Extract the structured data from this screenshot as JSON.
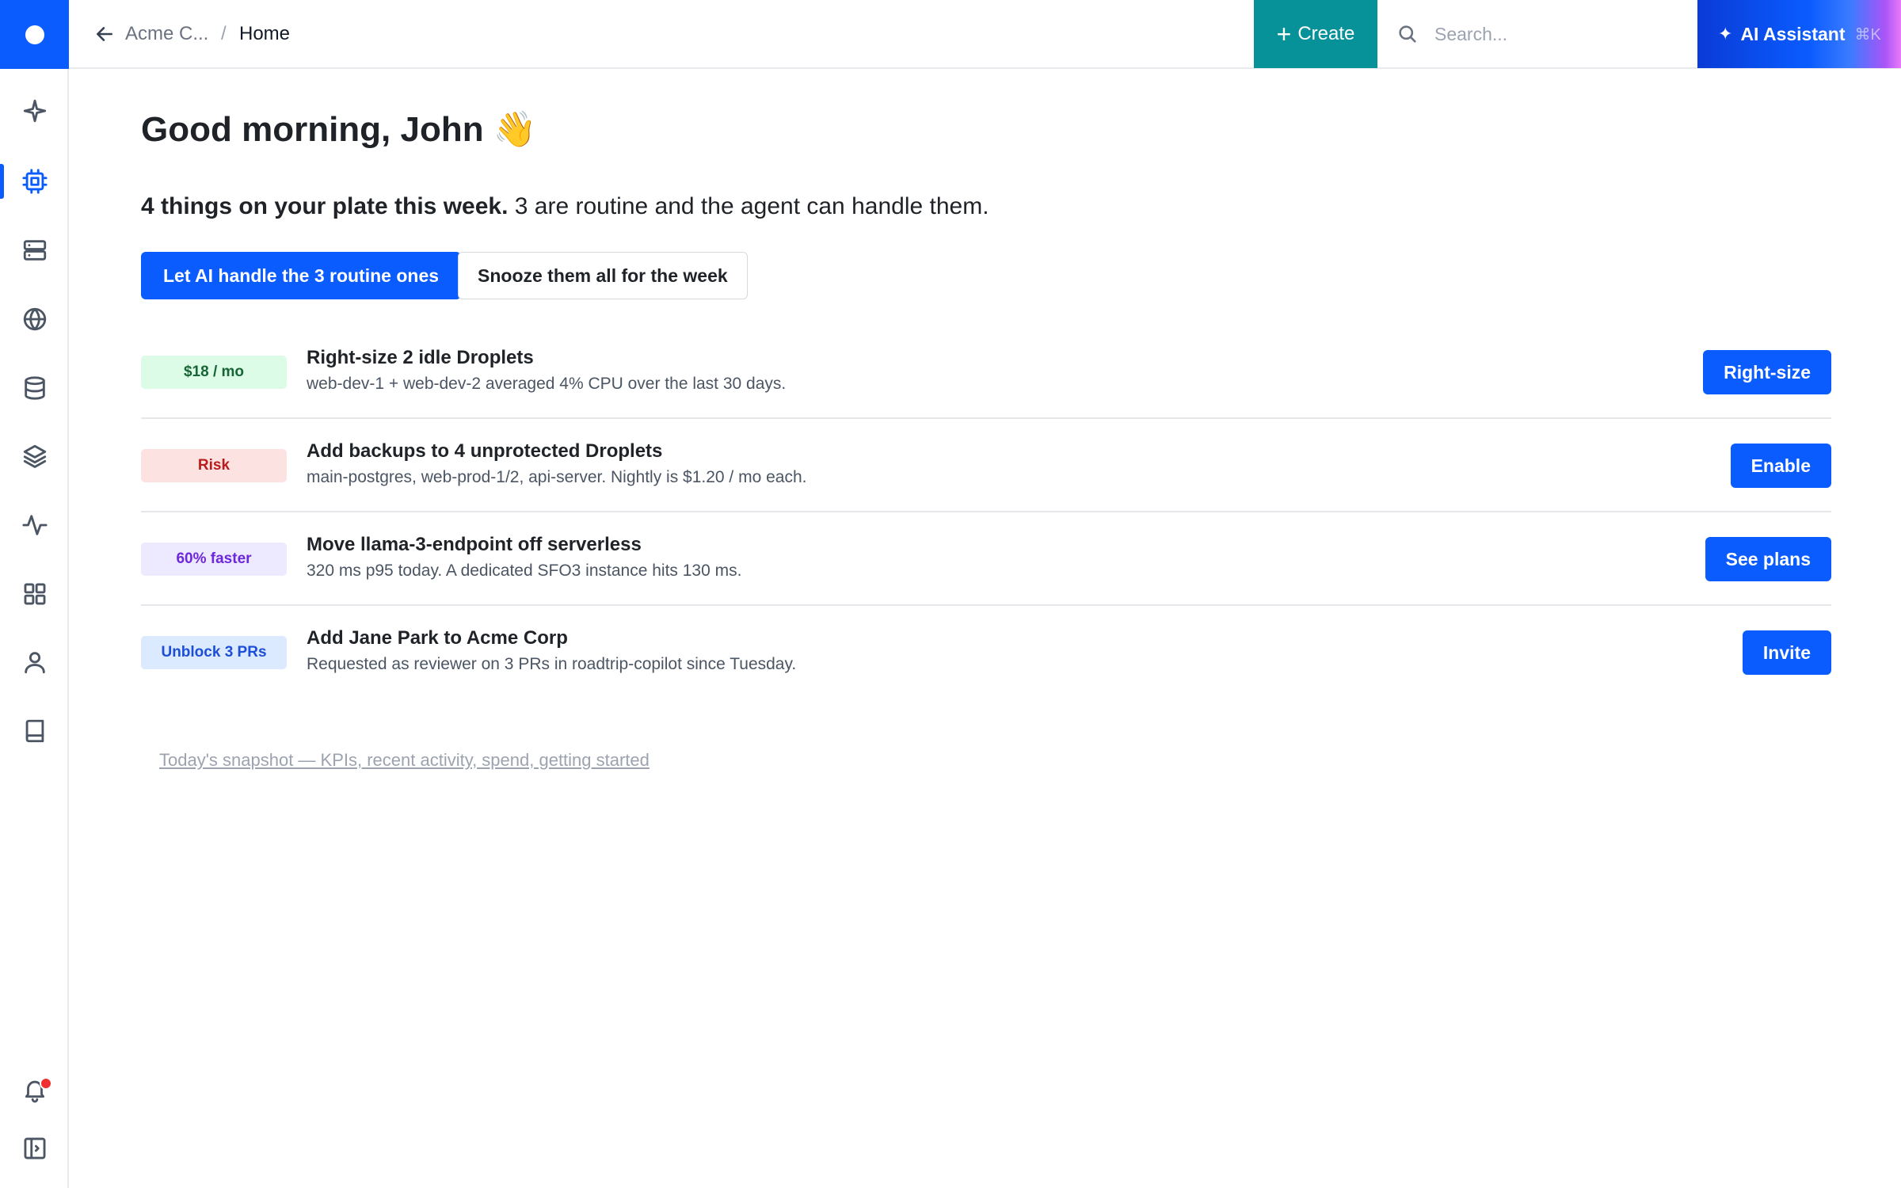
{
  "topbar": {
    "org_crumb": "Acme C...",
    "separator": "/",
    "current_crumb": "Home",
    "create_label": "Create",
    "search_placeholder": "Search...",
    "ai_label": "AI Assistant",
    "ai_shortcut": "⌘K"
  },
  "sidebar": {
    "items": [
      {
        "icon": "sparkle-icon"
      },
      {
        "icon": "cpu-icon",
        "active": true
      },
      {
        "icon": "server-icon"
      },
      {
        "icon": "globe-icon"
      },
      {
        "icon": "database-icon"
      },
      {
        "icon": "layers-icon"
      },
      {
        "icon": "activity-icon"
      },
      {
        "icon": "grid-icon"
      },
      {
        "icon": "user-icon"
      },
      {
        "icon": "book-icon"
      },
      {
        "icon": "bell-icon",
        "has_notification": true
      },
      {
        "icon": "sidebar-toggle-icon"
      }
    ]
  },
  "main": {
    "greeting": "Good morning, John 👋",
    "summary_bold": "4 things on your plate this week.",
    "summary_rest": " 3 are routine and the agent can handle them.",
    "primary_action": "Let AI handle the 3 routine ones",
    "secondary_action": "Snooze them all for the week",
    "snapshot_link": "Today's snapshot — KPIs, recent activity, spend, getting started"
  },
  "tasks": [
    {
      "badge": "$18 / mo",
      "badge_bg": "#dcfce7",
      "badge_color": "#166534",
      "title": "Right-size 2 idle Droplets",
      "desc": "web-dev-1 + web-dev-2 averaged 4% CPU over the last 30 days.",
      "action": "Right-size"
    },
    {
      "badge": "Risk",
      "badge_bg": "#fde2e2",
      "badge_color": "#b91c1c",
      "title": "Add backups to 4 unprotected Droplets",
      "desc": "main-postgres, web-prod-1/2, api-server. Nightly is $1.20 / mo each.",
      "action": "Enable"
    },
    {
      "badge": "60% faster",
      "badge_bg": "#ede9fe",
      "badge_color": "#6d28d9",
      "title": "Move llama-3-endpoint off serverless",
      "desc": "320 ms p95 today. A dedicated SFO3 instance hits 130 ms.",
      "action": "See plans"
    },
    {
      "badge": "Unblock 3 PRs",
      "badge_bg": "#dbeafe",
      "badge_color": "#1d4ed8",
      "title": "Add Jane Park to Acme Corp",
      "desc": "Requested as reviewer on 3 PRs in roadtrip-copilot since Tuesday.",
      "action": "Invite"
    }
  ],
  "colors": {
    "brand": "#0a5cff",
    "create": "#079199"
  }
}
